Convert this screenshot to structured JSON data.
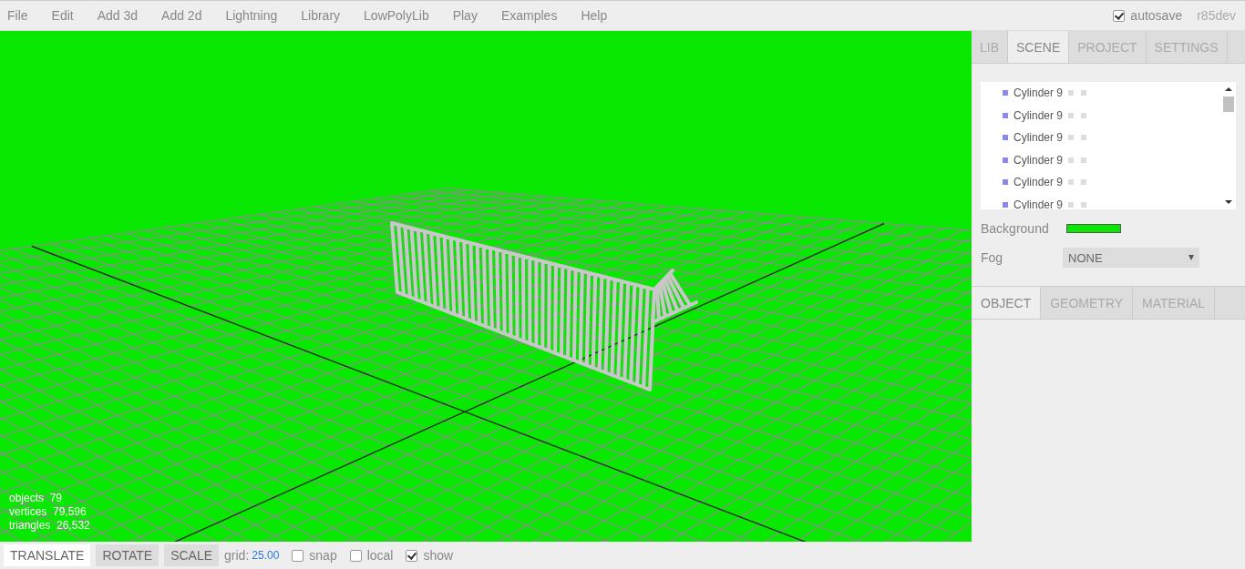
{
  "menu": [
    "File",
    "Edit",
    "Add 3d",
    "Add 2d",
    "Lightning",
    "Library",
    "LowPolyLib",
    "Play",
    "Examples",
    "Help"
  ],
  "autosave": {
    "label": "autosave",
    "checked": true
  },
  "version": "r85dev",
  "stats": [
    {
      "label": "objects",
      "value": "79"
    },
    {
      "label": "vertices",
      "value": "79,596"
    },
    {
      "label": "triangles",
      "value": "26,532"
    }
  ],
  "toolbar": {
    "modes": [
      {
        "label": "TRANSLATE",
        "selected": true
      },
      {
        "label": "ROTATE",
        "selected": false
      },
      {
        "label": "SCALE",
        "selected": false
      }
    ],
    "grid_label": "grid:",
    "grid_value": "25.00",
    "options": [
      {
        "label": "snap",
        "checked": false
      },
      {
        "label": "local",
        "checked": false
      },
      {
        "label": "show",
        "checked": true
      }
    ]
  },
  "sidebar": {
    "tabs": [
      {
        "label": "LIB",
        "selected": false
      },
      {
        "label": "SCENE",
        "selected": true
      },
      {
        "label": "PROJECT",
        "selected": false
      },
      {
        "label": "SETTINGS",
        "selected": false
      }
    ],
    "outliner": [
      "Cylinder 9",
      "Cylinder 9",
      "Cylinder 9",
      "Cylinder 9",
      "Cylinder 9",
      "Cylinder 9"
    ],
    "background": {
      "label": "Background",
      "color": "#08e800"
    },
    "fog": {
      "label": "Fog",
      "value": "NONE"
    },
    "lower_tabs": [
      {
        "label": "OBJECT",
        "selected": true
      },
      {
        "label": "GEOMETRY",
        "selected": false
      },
      {
        "label": "MATERIAL",
        "selected": false
      }
    ]
  }
}
